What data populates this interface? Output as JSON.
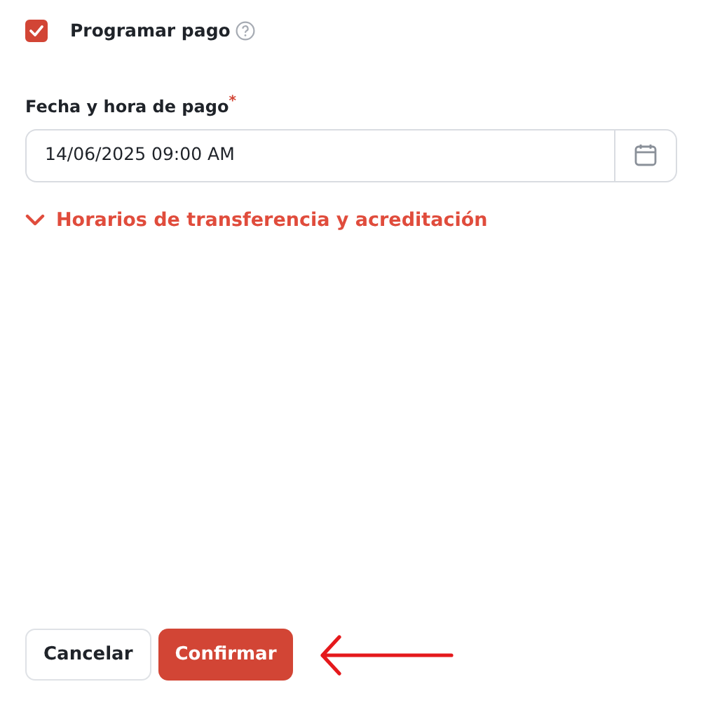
{
  "schedule_checkbox": {
    "label": "Programar pago",
    "checked": true
  },
  "date_field": {
    "label": "Fecha y hora de pago",
    "required_mark": "*",
    "value": "14/06/2025 09:00 AM"
  },
  "expander": {
    "label": "Horarios de transferencia y acreditación",
    "expanded": false
  },
  "buttons": [
    {
      "label": "Cancelar",
      "kind": "secondary"
    },
    {
      "label": "Confirmar",
      "kind": "primary"
    }
  ]
}
